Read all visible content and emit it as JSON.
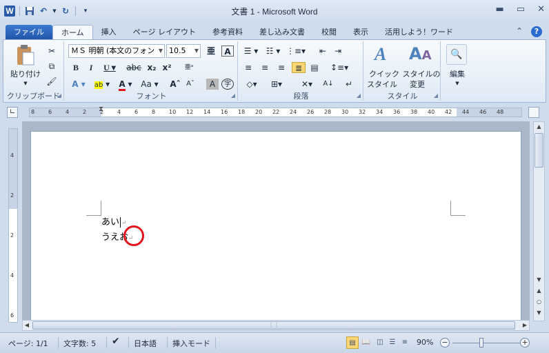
{
  "window": {
    "title": "文書 1 - Microsoft Word",
    "app_icon": "W",
    "buttons": [
      "minimize-icon",
      "maximize-icon",
      "close-icon"
    ]
  },
  "qat": {
    "save_icon": "save-icon",
    "undo_icon": "undo-icon",
    "redo_icon": "redo-icon",
    "customize_icon": "customize-icon"
  },
  "tabs": [
    {
      "label": "ファイル"
    },
    {
      "label": "ホーム"
    },
    {
      "label": "挿入"
    },
    {
      "label": "ページ レイアウト"
    },
    {
      "label": "参考資料"
    },
    {
      "label": "差し込み文書"
    },
    {
      "label": "校閲"
    },
    {
      "label": "表示"
    },
    {
      "label": "活用しよう！ワード"
    }
  ],
  "ribbon": {
    "clipboard": {
      "label": "クリップボード",
      "paste_label": "貼り付け"
    },
    "font": {
      "label": "フォント",
      "font_name": "ＭＳ 明朝 (本文のフォン",
      "font_size": "10.5"
    },
    "paragraph": {
      "label": "段落"
    },
    "styles": {
      "label": "スタイル",
      "quick_style_line1": "クイック",
      "quick_style_line2": "スタイル",
      "change_style_line1": "スタイルの",
      "change_style_line2": "変更"
    },
    "editing": {
      "label": "編集"
    }
  },
  "ruler": {
    "h_ticks": [
      "8",
      "6",
      "4",
      "2",
      "2",
      "4",
      "6",
      "8",
      "10",
      "12",
      "14",
      "16",
      "18",
      "20",
      "22",
      "24",
      "26",
      "28",
      "30",
      "32",
      "34",
      "36",
      "38",
      "40",
      "42",
      "44",
      "46",
      "48"
    ],
    "v_ticks": [
      "4",
      "2",
      "2",
      "4",
      "6"
    ]
  },
  "document": {
    "line1": "あい",
    "line2": "うえお",
    "paragraph_mark": "↵"
  },
  "status": {
    "page": "ページ: 1/1",
    "word_count": "文字数: 5",
    "language": "日本語",
    "mode": "挿入モード",
    "zoom": "90%",
    "zoom_level": 0.9
  }
}
